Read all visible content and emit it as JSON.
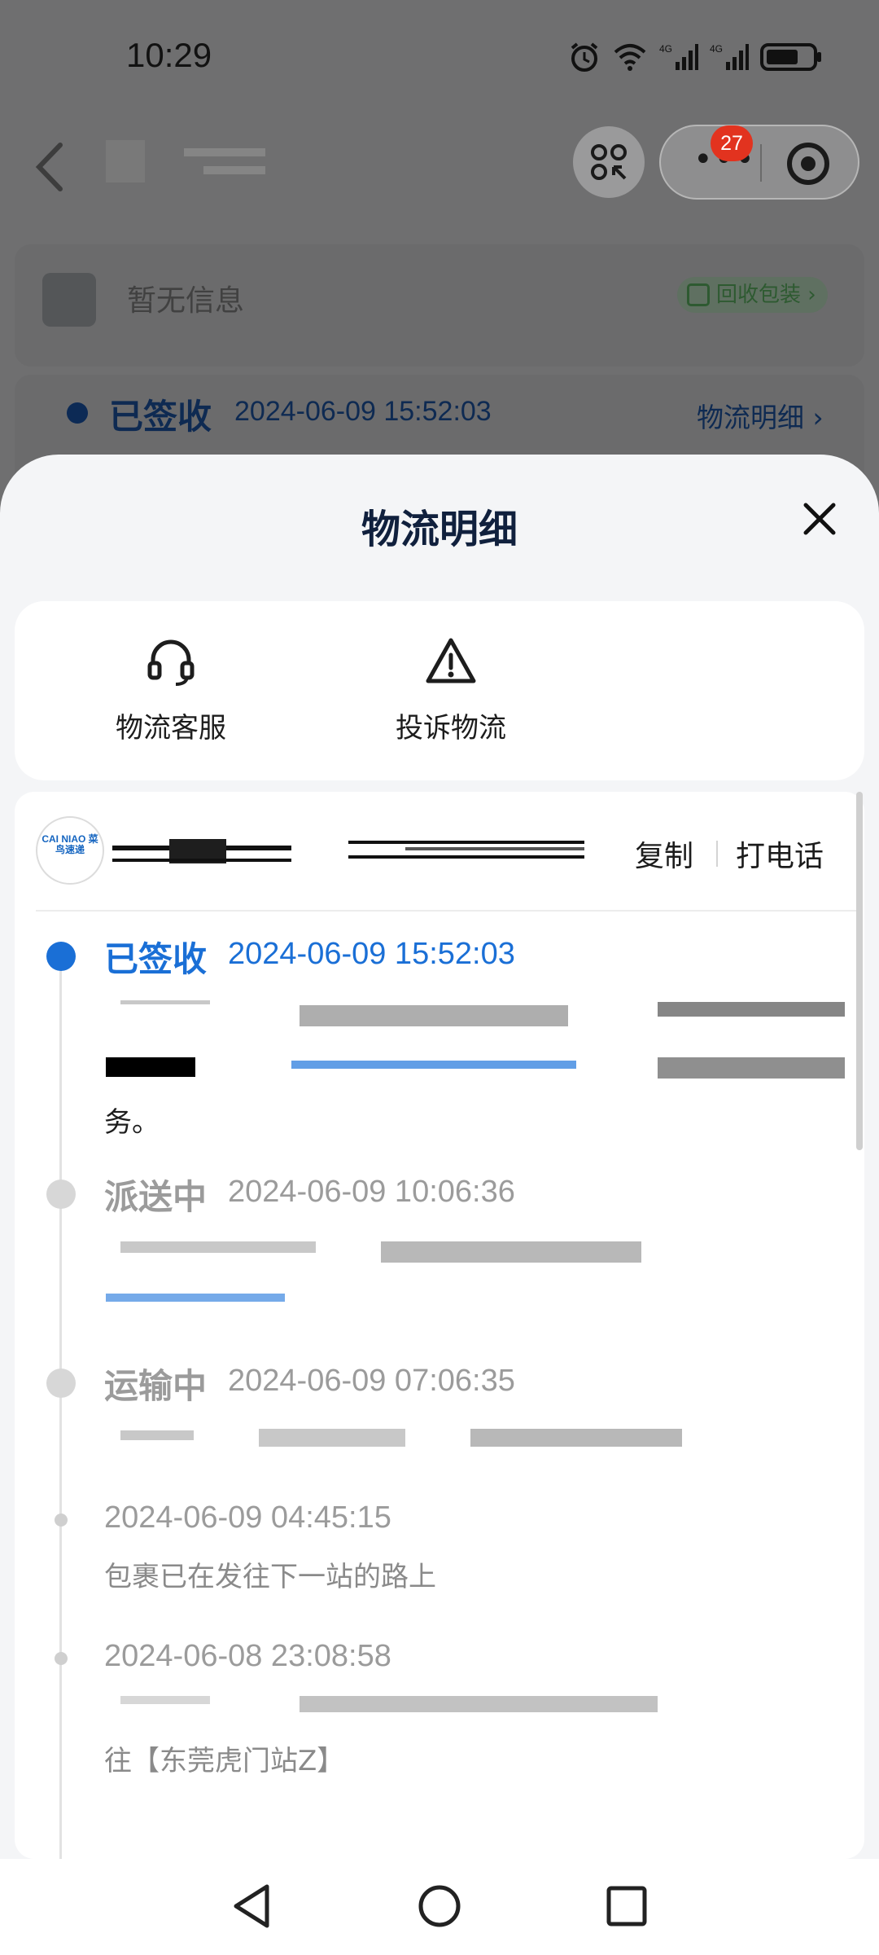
{
  "status_bar": {
    "time": "10:29"
  },
  "capsule": {
    "badge": "27"
  },
  "background": {
    "no_info": "暂无信息",
    "recycle": "回收包装",
    "signed_status": "已签收",
    "signed_time": "2024-06-09 15:52:03",
    "detail_link": "物流明细 ›"
  },
  "sheet": {
    "title": "物流明细",
    "actions": [
      {
        "label": "物流客服",
        "icon": "headset-icon"
      },
      {
        "label": "投诉物流",
        "icon": "warning-icon"
      }
    ],
    "courier": {
      "logo_text": "CAI NIAO 菜鸟速递",
      "copy": "复制",
      "call": "打电话"
    },
    "events": [
      {
        "status": "已签收",
        "time": "2024-06-09 15:52:03",
        "desc_tail": "务。"
      },
      {
        "status": "派送中",
        "time": "2024-06-09 10:06:36"
      },
      {
        "status": "运输中",
        "time": "2024-06-09 07:06:35"
      },
      {
        "status": "",
        "time": "2024-06-09 04:45:15",
        "desc": "包裹已在发往下一站的路上"
      },
      {
        "status": "",
        "time": "2024-06-08 23:08:58",
        "desc": "往【东莞虎门站Z】"
      }
    ]
  },
  "colors": {
    "accent": "#1a6fd6",
    "inactive": "#9b9b9b"
  }
}
